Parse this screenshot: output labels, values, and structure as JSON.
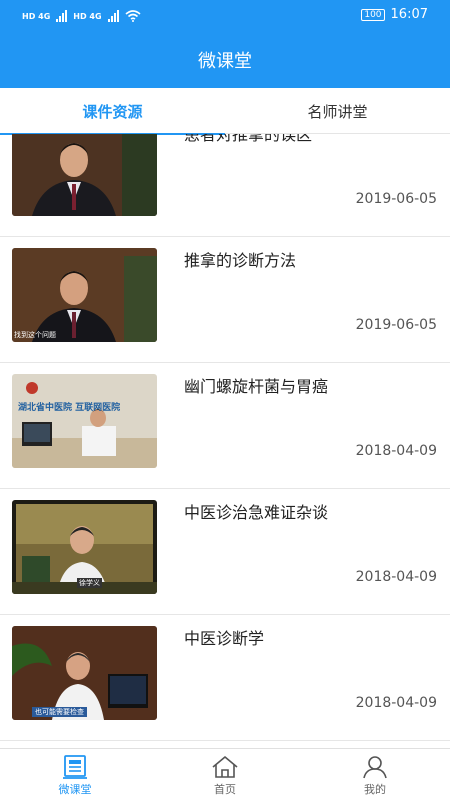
{
  "status_bar": {
    "network_1": "HD 4G",
    "network_2": "HD 4G",
    "battery": "100",
    "time": "16:07"
  },
  "header": {
    "title": "微课堂"
  },
  "tabs": [
    {
      "label": "课件资源",
      "active": true
    },
    {
      "label": "名师讲堂",
      "active": false
    }
  ],
  "courses": [
    {
      "title": "患者对推拿的误区",
      "date": "2019-06-05"
    },
    {
      "title": "推拿的诊断方法",
      "date": "2019-06-05",
      "thumb_caption": "找到这个问题"
    },
    {
      "title": "幽门螺旋杆菌与胃癌",
      "date": "2018-04-09",
      "thumb_caption": "湖北省中医院 互联网医院"
    },
    {
      "title": "中医诊治急难证杂谈",
      "date": "2018-04-09",
      "thumb_caption": "徐学义"
    },
    {
      "title": "中医诊断学",
      "date": "2018-04-09",
      "thumb_caption": "也可能需要检查"
    }
  ],
  "bottom_nav": [
    {
      "label": "微课堂",
      "icon": "news-icon",
      "active": true
    },
    {
      "label": "首页",
      "icon": "home-icon",
      "active": false
    },
    {
      "label": "我的",
      "icon": "user-icon",
      "active": false
    }
  ],
  "colors": {
    "primary": "#2196f3",
    "text": "#222222",
    "date": "#555555"
  }
}
